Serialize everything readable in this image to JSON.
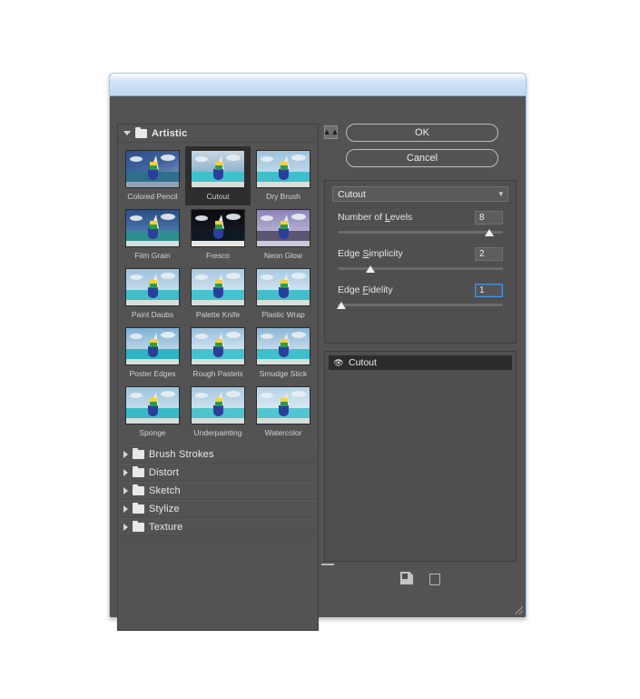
{
  "window": {
    "title": "",
    "ok_label": "OK",
    "cancel_label": "Cancel",
    "collapse_icon": "double-chevron-up-icon"
  },
  "browser": {
    "category": {
      "name": "Artistic",
      "expanded": true,
      "disclosure_icon": "triangle-down-icon",
      "folder_icon": "folder-icon"
    },
    "selected_filter": "Cutout",
    "filters": [
      {
        "label": "Colored Pencil",
        "selected": false
      },
      {
        "label": "Cutout",
        "selected": true
      },
      {
        "label": "Dry Brush",
        "selected": false
      },
      {
        "label": "Film Grain",
        "selected": false
      },
      {
        "label": "Fresco",
        "selected": false
      },
      {
        "label": "Neon Glow",
        "selected": false
      },
      {
        "label": "Paint Daubs",
        "selected": false
      },
      {
        "label": "Palette Knife",
        "selected": false
      },
      {
        "label": "Plastic Wrap",
        "selected": false
      },
      {
        "label": "Poster Edges",
        "selected": false
      },
      {
        "label": "Rough Pastels",
        "selected": false
      },
      {
        "label": "Smudge Stick",
        "selected": false
      },
      {
        "label": "Sponge",
        "selected": false
      },
      {
        "label": "Underpainting",
        "selected": false
      },
      {
        "label": "Watercolor",
        "selected": false
      }
    ],
    "categories": [
      {
        "label": "Brush Strokes",
        "expanded": false
      },
      {
        "label": "Distort",
        "expanded": false
      },
      {
        "label": "Sketch",
        "expanded": false
      },
      {
        "label": "Stylize",
        "expanded": false
      },
      {
        "label": "Texture",
        "expanded": false
      }
    ]
  },
  "settings": {
    "filter_select": "Cutout",
    "chevron_icon": "chevron-down-icon",
    "controls": [
      {
        "label_before": "Number of ",
        "label_mnemonic": "L",
        "label_after": "evels",
        "value": "8",
        "slider_percent": 92,
        "focused": false
      },
      {
        "label_before": "Edge ",
        "label_mnemonic": "S",
        "label_after": "implicity",
        "value": "2",
        "slider_percent": 20,
        "focused": false
      },
      {
        "label_before": "Edge ",
        "label_mnemonic": "F",
        "label_after": "idelity",
        "value": "1",
        "slider_percent": 2,
        "focused": true
      }
    ]
  },
  "layers": {
    "items": [
      {
        "name": "Cutout",
        "visible": true,
        "visibility_icon": "eye-icon"
      }
    ],
    "new_layer_icon": "new-effect-layer-icon",
    "delete_layer_icon": "trash-icon",
    "resize_grip_icon": "resize-grip-icon"
  }
}
